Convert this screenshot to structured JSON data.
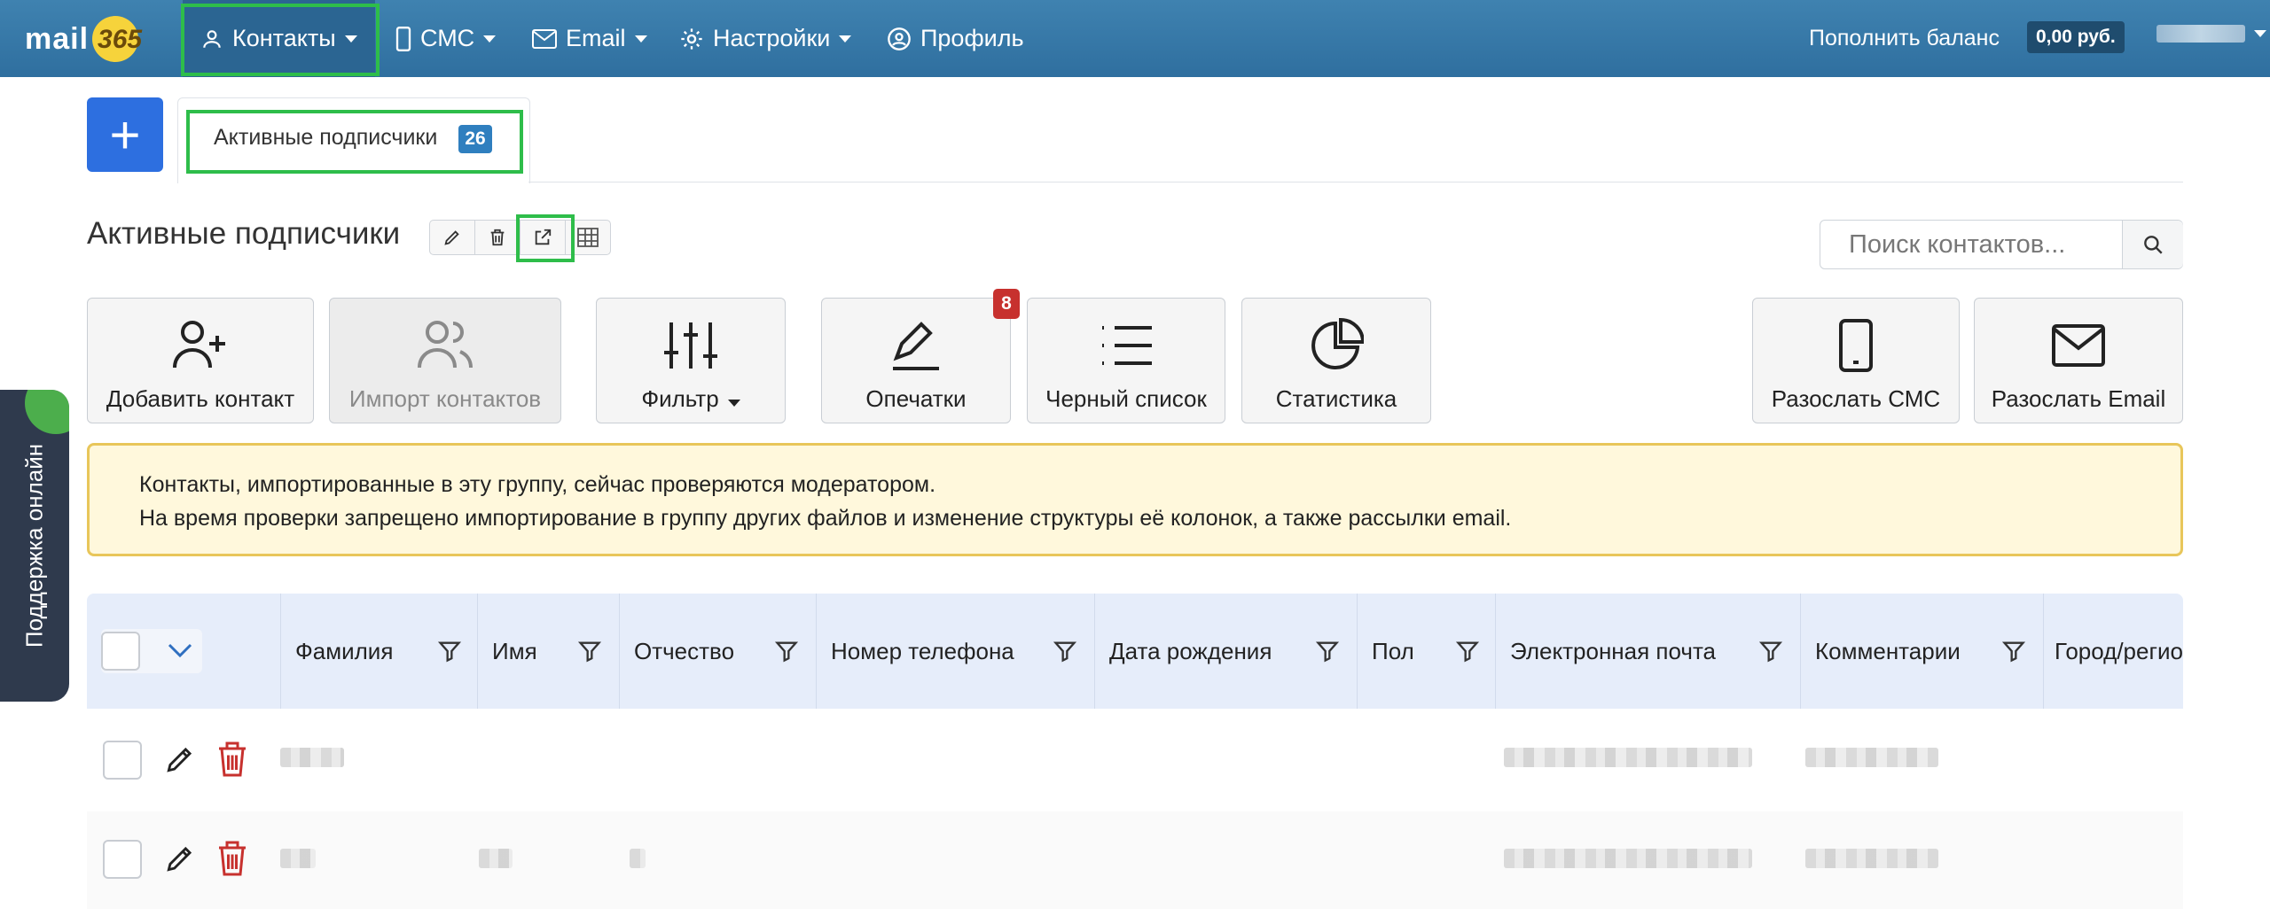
{
  "app": {
    "logo_text": "mail",
    "logo_number": "365"
  },
  "nav": {
    "items": [
      {
        "label": "Контакты",
        "icon": "user-icon"
      },
      {
        "label": "СМС",
        "icon": "phone-icon"
      },
      {
        "label": "Email",
        "icon": "envelope-icon"
      },
      {
        "label": "Настройки",
        "icon": "gear-icon"
      },
      {
        "label": "Профиль",
        "icon": "user-circle-icon"
      }
    ],
    "balance_label": "Пополнить баланс",
    "balance_value": "0,00 руб."
  },
  "tabs": [
    {
      "label": "Активные подписчики",
      "count": "26"
    }
  ],
  "page": {
    "title": "Активные подписчики"
  },
  "search": {
    "placeholder": "Поиск контактов..."
  },
  "actions": [
    {
      "label": "Добавить контакт",
      "icon": "user-plus-icon"
    },
    {
      "label": "Импорт контактов",
      "icon": "users-icon",
      "disabled": true
    },
    {
      "label": "Фильтр",
      "icon": "sliders-icon"
    },
    {
      "label": "Опечатки",
      "icon": "pen-icon",
      "badge": "8"
    },
    {
      "label": "Черный список",
      "icon": "list-icon"
    },
    {
      "label": "Статистика",
      "icon": "pie-chart-icon"
    },
    {
      "label": "Разослать СМС",
      "icon": "mobile-icon"
    },
    {
      "label": "Разослать Email",
      "icon": "envelope-icon"
    }
  ],
  "alert": {
    "line1": "Контакты, импортированные в эту группу, сейчас проверяются модератором.",
    "line2": "На время проверки запрещено импортирование в группу других файлов и изменение структуры её колонок, а также рассылки email."
  },
  "table": {
    "columns": [
      "Фамилия",
      "Имя",
      "Отчество",
      "Номер телефона",
      "Дата рождения",
      "Пол",
      "Электронная почта",
      "Комментарии",
      "Город/регион"
    ]
  },
  "support": {
    "label": "Поддержка онлайн"
  },
  "colors": {
    "navbar": "#3578a8",
    "primary": "#2d6fe0",
    "badge_blue": "#2f7fbf",
    "badge_red": "#c7312e",
    "highlight": "#2ebd4a",
    "alert_bg": "#fff8dc",
    "alert_border": "#e8c65a",
    "table_head": "#e6edfa",
    "support_bg": "#2f3a4d"
  }
}
